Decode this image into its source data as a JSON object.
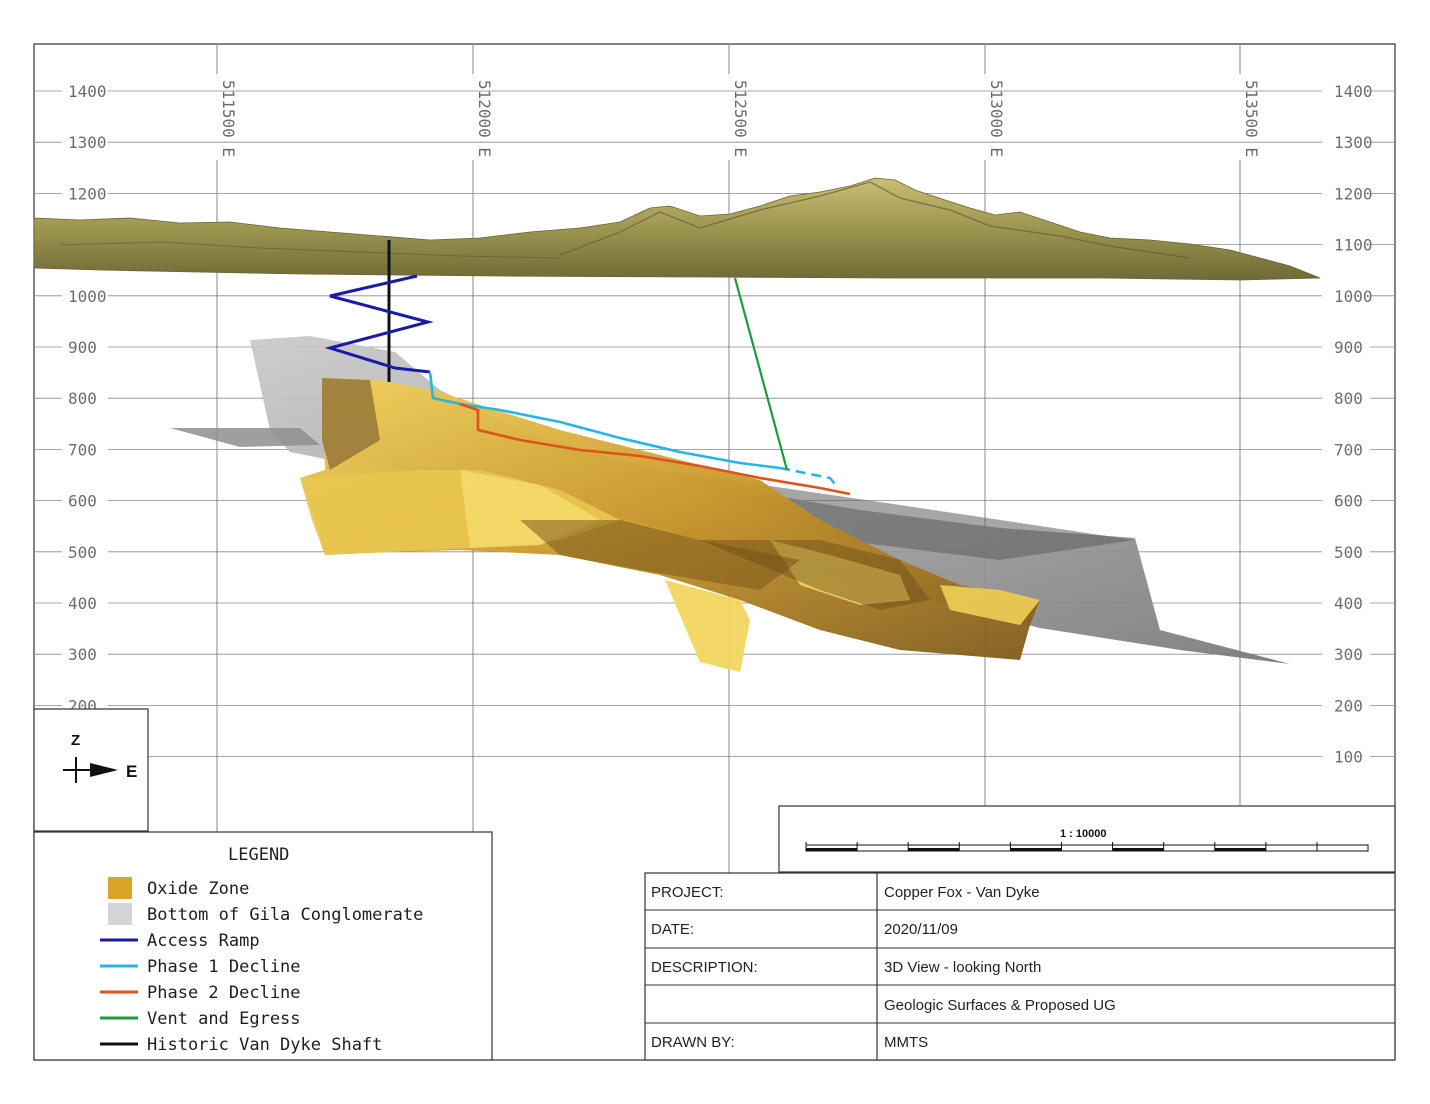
{
  "elevation_labels": [
    "1400",
    "1300",
    "1200",
    "1100",
    "1000",
    "900",
    "800",
    "700",
    "600",
    "500",
    "400",
    "300",
    "200",
    "100"
  ],
  "easting_labels": [
    "511500 E",
    "512000 E",
    "512500 E",
    "513000 E",
    "513500 E"
  ],
  "orientation": {
    "up_label": "Z",
    "right_label": "E"
  },
  "legend": {
    "title": "LEGEND",
    "items": [
      {
        "label": "Oxide Zone",
        "color": "#d8a52a",
        "kind": "swatch"
      },
      {
        "label": "Bottom of Gila Conglomerate",
        "color": "#d4d4d4",
        "kind": "swatch"
      },
      {
        "label": "Access Ramp",
        "color": "#1a1aa6",
        "kind": "line"
      },
      {
        "label": "Phase 1 Decline",
        "color": "#28b4e6",
        "kind": "line"
      },
      {
        "label": "Phase 2 Decline",
        "color": "#e0521c",
        "kind": "line"
      },
      {
        "label": "Vent and Egress",
        "color": "#1f9a3a",
        "kind": "line"
      },
      {
        "label": "Historic Van Dyke Shaft",
        "color": "#111111",
        "kind": "line"
      }
    ]
  },
  "scale": {
    "label": "1 : 10000"
  },
  "title_block": {
    "rows": [
      {
        "key": "PROJECT:",
        "value": "Copper Fox - Van Dyke"
      },
      {
        "key": "DATE:",
        "value": "2020/11/09"
      },
      {
        "key": "DESCRIPTION:",
        "value": "3D View - looking North"
      },
      {
        "key": "",
        "value": "Geologic Surfaces & Proposed UG"
      },
      {
        "key": "DRAWN BY:",
        "value": "MMTS"
      }
    ]
  }
}
